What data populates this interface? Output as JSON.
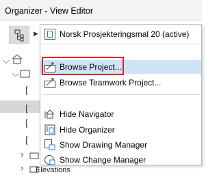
{
  "window": {
    "title": "Organizer - View Editor"
  },
  "toolbar": {
    "view_set_icon": "view-map-icon",
    "dropdown_icon": "triangle-right-icon"
  },
  "tree": {
    "partial_label": "Elevations"
  },
  "menu": {
    "items": [
      {
        "id": "template",
        "label": "Norsk Prosjekteringsmal 20 (active)",
        "icon": "project-template-icon"
      },
      {
        "id": "browse-project",
        "label": "Browse Project...",
        "icon": "browse-project-icon",
        "highlighted": true
      },
      {
        "id": "browse-teamwork",
        "label": "Browse Teamwork Project...",
        "icon": "teamwork-project-icon"
      },
      {
        "id": "hide-navigator",
        "label": "Hide Navigator",
        "icon": "navigator-icon"
      },
      {
        "id": "hide-organizer",
        "label": "Hide Organizer",
        "icon": "organizer-icon"
      },
      {
        "id": "show-drawing-manager",
        "label": "Show Drawing Manager",
        "icon": "drawing-manager-icon"
      },
      {
        "id": "show-change-manager",
        "label": "Show Change Manager",
        "icon": "change-manager-icon"
      }
    ]
  },
  "colors": {
    "highlight": "#cfe3f7",
    "annotation_red": "#e0201b",
    "icon_blue": "#2b7bd1"
  }
}
